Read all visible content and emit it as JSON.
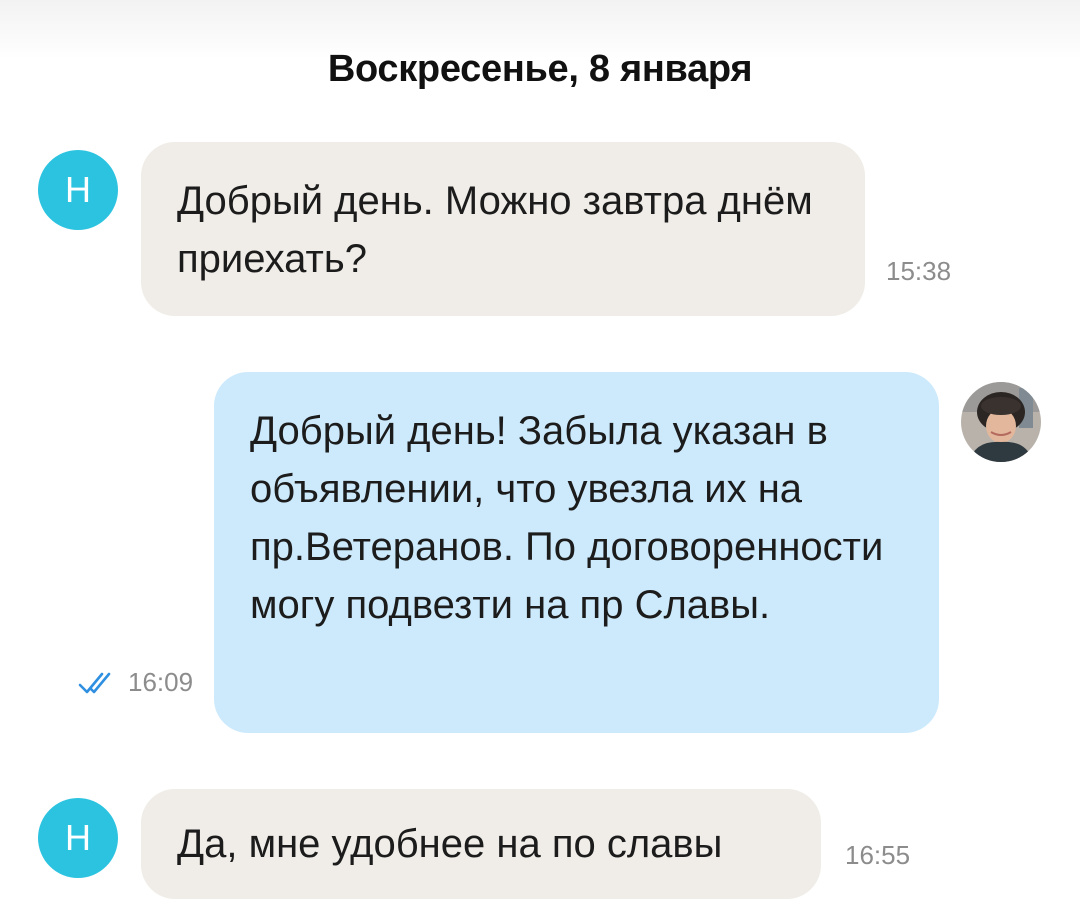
{
  "date_header": "Воскресенье, 8 января",
  "messages": [
    {
      "direction": "incoming",
      "avatar_letter": "Н",
      "text": "Добрый день. Можно завтра днём приехать?",
      "time": "15:38"
    },
    {
      "direction": "outgoing",
      "avatar": "user-photo-avatar",
      "text": "Добрый день! Забыла указан в объявлении, что увезла их на пр.Ветеранов. По договоренности могу подвезти на пр Славы.",
      "time": "16:09",
      "status_icon": "double-check-icon"
    },
    {
      "direction": "incoming",
      "avatar_letter": "Н",
      "text": "Да, мне удобнее на по славы",
      "time": "16:55"
    }
  ],
  "colors": {
    "incoming_bubble": "#f0ede8",
    "outgoing_bubble": "#cdeafc",
    "avatar": "#2cc3e0",
    "read_check": "#2f8fe0",
    "timestamp": "#8c8c8c"
  }
}
